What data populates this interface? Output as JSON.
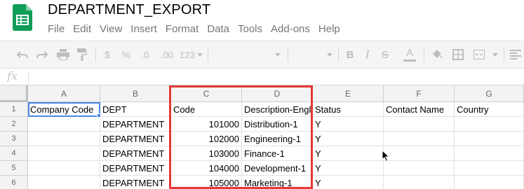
{
  "doc": {
    "title": "DEPARTMENT_EXPORT"
  },
  "menu": [
    "File",
    "Edit",
    "View",
    "Insert",
    "Format",
    "Data",
    "Tools",
    "Add-ons",
    "Help"
  ],
  "toolbar": {
    "currency_label": "$",
    "percent_label": "%",
    "decrease_decimals_label": ".0",
    "increase_decimals_label": ".00",
    "more_formats_label": "123",
    "bold_label": "B",
    "italic_label": "I",
    "strikethrough_label": "S",
    "text_color_label": "A"
  },
  "formula_bar": {
    "fx_label": "fx",
    "value": ""
  },
  "columns": [
    "A",
    "B",
    "C",
    "D",
    "E",
    "F",
    "G"
  ],
  "rows": [
    "1",
    "2",
    "3",
    "4",
    "5",
    "6"
  ],
  "cells": [
    [
      "Company Code",
      "DEPT",
      "Code",
      "Description-English",
      "Status",
      "Contact Name",
      "Country"
    ],
    [
      "",
      "DEPARTMENT",
      "101000",
      "Distribution-1",
      "Y",
      "",
      ""
    ],
    [
      "",
      "DEPARTMENT",
      "102000",
      "Engineering-1",
      "Y",
      "",
      ""
    ],
    [
      "",
      "DEPARTMENT",
      "103000",
      "Finance-1",
      "Y",
      "",
      ""
    ],
    [
      "",
      "DEPARTMENT",
      "104000",
      "Development-1",
      "Y",
      "",
      ""
    ],
    [
      "",
      "DEPARTMENT",
      "105000",
      "Marketing-1",
      "Y",
      "",
      ""
    ]
  ],
  "colors": {
    "sheets_green": "#0f9d58",
    "selection_blue": "#4a86e8",
    "highlight_red": "#e53935"
  }
}
